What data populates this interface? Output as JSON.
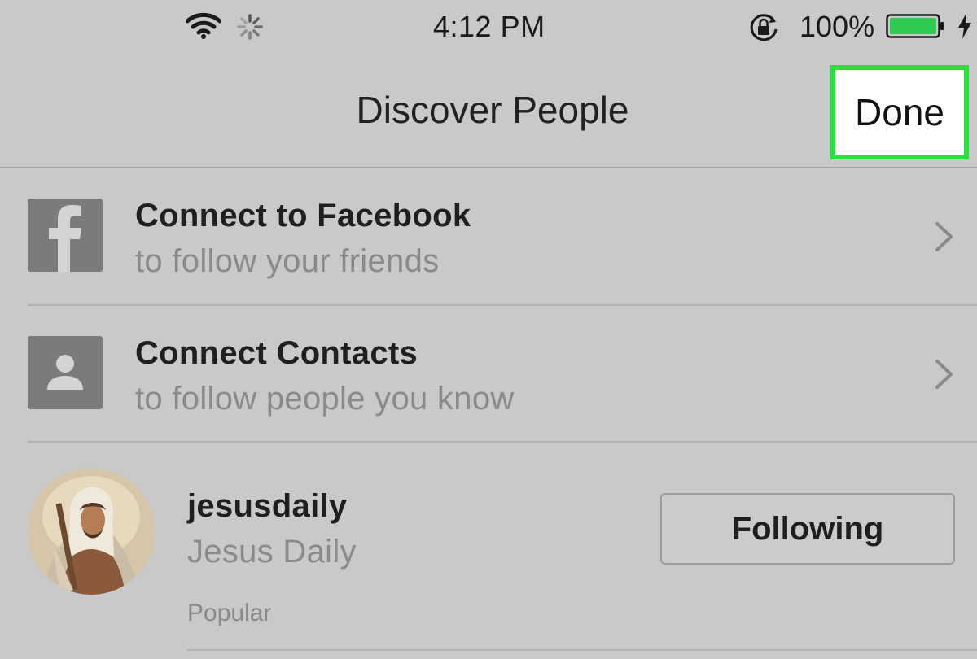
{
  "status_bar": {
    "time": "4:12 PM",
    "battery_percent": "100%",
    "battery_level": 1.0,
    "battery_color": "#2dcc50",
    "icons": [
      "wifi-icon",
      "activity-spinner-icon",
      "orientation-lock-icon",
      "battery-icon",
      "charging-bolt-icon"
    ]
  },
  "nav": {
    "title": "Discover People",
    "done_label": "Done",
    "highlight_color": "#25e23a"
  },
  "connect_rows": [
    {
      "icon": "facebook-icon",
      "title": "Connect to Facebook",
      "subtitle": "to follow your friends"
    },
    {
      "icon": "contact-icon",
      "title": "Connect Contacts",
      "subtitle": "to follow people you know"
    }
  ],
  "suggestions": [
    {
      "username": "jesusdaily",
      "full_name": "Jesus Daily",
      "button_label": "Following",
      "reason": "Popular"
    }
  ]
}
